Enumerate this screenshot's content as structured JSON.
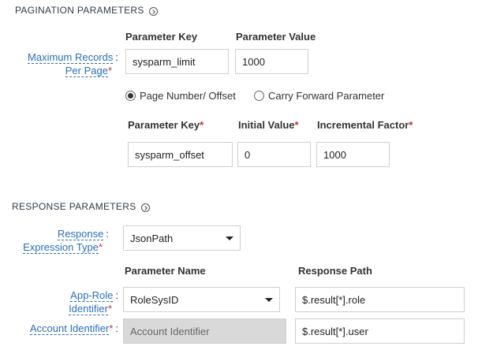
{
  "pagination": {
    "title": "PAGINATION PARAMETERS",
    "info_icon": "info-circle-icon",
    "header_key": "Parameter Key",
    "header_value": "Parameter Value",
    "max_records_label_1": "Maximum Records",
    "max_records_label_2": "Per Page",
    "max_records_key": "sysparm_limit",
    "max_records_value": "1000",
    "radio_page_number": "Page Number/ Offset",
    "radio_carry_forward": "Carry Forward Parameter",
    "selected_option": "Page Number/ Offset",
    "offset_header_key": "Parameter Key",
    "offset_header_initial": "Initial Value",
    "offset_header_increment": "Incremental Factor",
    "offset_key": "sysparm_offset",
    "offset_initial": "0",
    "offset_increment": "1000"
  },
  "response": {
    "title": "RESPONSE PARAMETERS",
    "info_icon": "info-circle-icon",
    "expr_label_1": "Response",
    "expr_label_2": "Expression Type",
    "expr_value": "JsonPath",
    "header_name": "Parameter Name",
    "header_path": "Response Path",
    "app_role_label_1": "App-Role",
    "app_role_label_2": "Identifier",
    "app_role_name": "RoleSysID",
    "app_role_path": "$.result[*].role",
    "account_label": "Account Identifier",
    "account_name_placeholder": "Account Identifier",
    "account_path": "$.result[*].user"
  },
  "colors": {
    "link_blue": "#2a6ebb",
    "required_red": "#c9302c",
    "disabled_gray": "#d9d9d9"
  }
}
